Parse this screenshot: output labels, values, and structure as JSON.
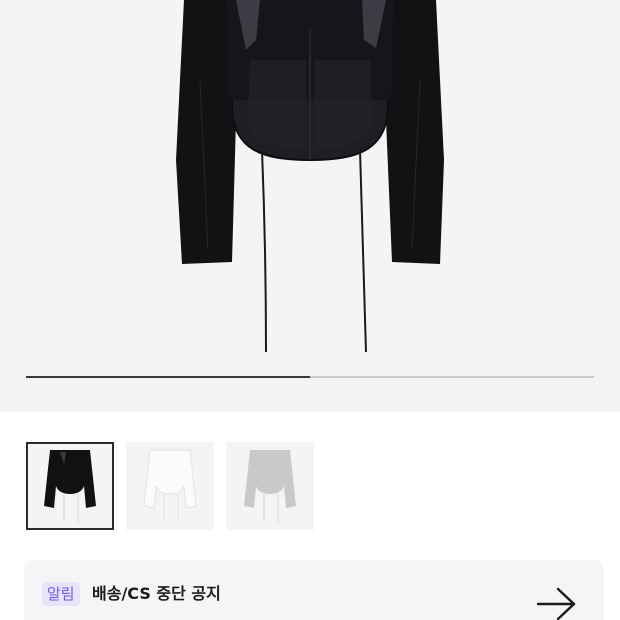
{
  "gallery": {
    "progress_fraction": 0.5,
    "thumbnails": [
      {
        "color": "black",
        "selected": true
      },
      {
        "color": "white",
        "selected": false
      },
      {
        "color": "gray",
        "selected": false
      }
    ]
  },
  "notice": {
    "badge": "알림",
    "title": "배송/CS 중단 공지",
    "subtitle": "",
    "arrow_icon": "arrow-right-icon"
  },
  "colors": {
    "badge_bg": "#e7e3fb",
    "badge_text": "#6c5ce7",
    "hero_bg": "#f4f4f5"
  }
}
